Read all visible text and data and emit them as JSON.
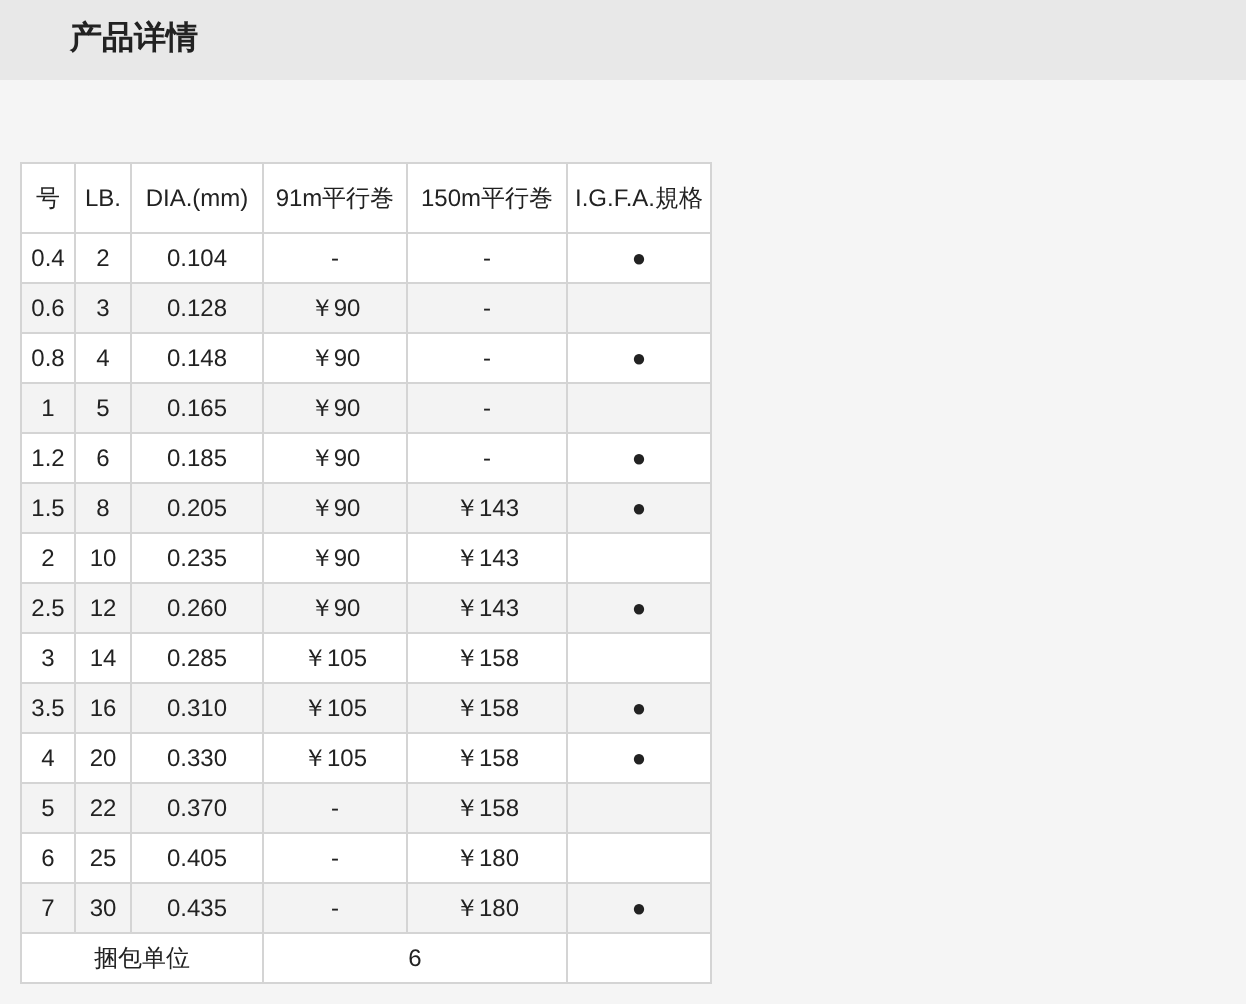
{
  "header": {
    "title": "产品详情"
  },
  "table": {
    "columns": [
      "号",
      "LB.",
      "DIA.(mm)",
      "91m平行巻",
      "150m平行巻",
      "I.G.F.A.規格"
    ],
    "rows": [
      {
        "no": "0.4",
        "lb": "2",
        "dia": "0.104",
        "m91": "-",
        "m150": "-",
        "igfa": "●"
      },
      {
        "no": "0.6",
        "lb": "3",
        "dia": "0.128",
        "m91": "￥90",
        "m150": "-"
      },
      {
        "no": "0.8",
        "lb": "4",
        "dia": "0.148",
        "m91": "￥90",
        "m150": "-",
        "igfa": "●"
      },
      {
        "no": "1",
        "lb": "5",
        "dia": "0.165",
        "m91": "￥90",
        "m150": "-"
      },
      {
        "no": "1.2",
        "lb": "6",
        "dia": "0.185",
        "m91": "￥90",
        "m150": "-",
        "igfa": "●"
      },
      {
        "no": "1.5",
        "lb": "8",
        "dia": "0.205",
        "m91": "￥90",
        "m150": "￥143",
        "igfa": "●"
      },
      {
        "no": "2",
        "lb": "10",
        "dia": "0.235",
        "m91": "￥90",
        "m150": "￥143"
      },
      {
        "no": "2.5",
        "lb": "12",
        "dia": "0.260",
        "m91": "￥90",
        "m150": "￥143",
        "igfa": "●"
      },
      {
        "no": "3",
        "lb": "14",
        "dia": "0.285",
        "m91": "￥105",
        "m150": "￥158"
      },
      {
        "no": "3.5",
        "lb": "16",
        "dia": "0.310",
        "m91": "￥105",
        "m150": "￥158",
        "igfa": "●"
      },
      {
        "no": "4",
        "lb": "20",
        "dia": "0.330",
        "m91": "￥105",
        "m150": "￥158",
        "igfa": "●"
      },
      {
        "no": "5",
        "lb": "22",
        "dia": "0.370",
        "m91": "-",
        "m150": "￥158"
      },
      {
        "no": "6",
        "lb": "25",
        "dia": "0.405",
        "m91": "-",
        "m150": "￥180"
      },
      {
        "no": "7",
        "lb": "30",
        "dia": "0.435",
        "m91": "-",
        "m150": "￥180",
        "igfa": "●"
      }
    ],
    "footer": {
      "label": "捆包单位",
      "value": "6"
    }
  }
}
